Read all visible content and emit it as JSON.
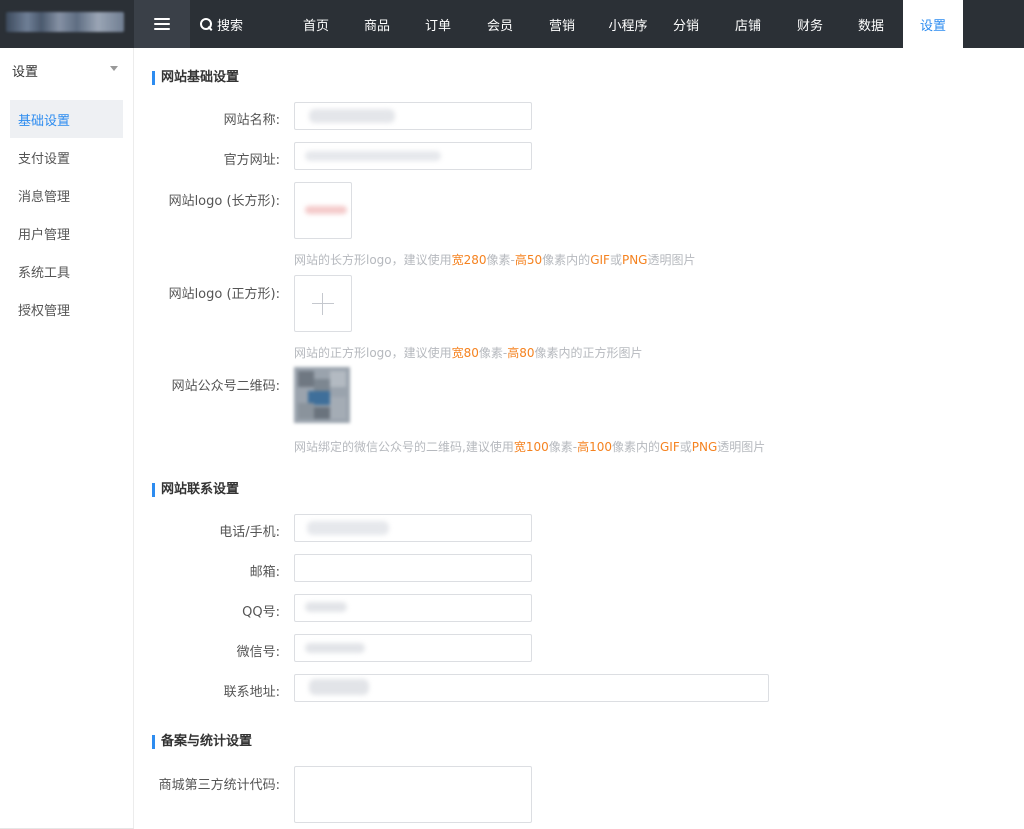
{
  "topbar": {
    "search_label": "搜索",
    "nav": [
      {
        "label": "首页"
      },
      {
        "label": "商品"
      },
      {
        "label": "订单"
      },
      {
        "label": "会员"
      },
      {
        "label": "营销"
      },
      {
        "label": "小程序"
      },
      {
        "label": "分销"
      },
      {
        "label": "店铺"
      },
      {
        "label": "财务"
      },
      {
        "label": "数据"
      },
      {
        "label": "设置",
        "active": true
      }
    ]
  },
  "sidebar": {
    "header": "设置",
    "items": [
      {
        "label": "基础设置",
        "active": true
      },
      {
        "label": "支付设置"
      },
      {
        "label": "消息管理"
      },
      {
        "label": "用户管理"
      },
      {
        "label": "系统工具"
      },
      {
        "label": "授权管理"
      }
    ]
  },
  "basic": {
    "title": "网站基础设置",
    "site_name_label": "网站名称:",
    "site_url_label": "官方网址:",
    "logo_rect_label": "网站logo (长方形):",
    "logo_rect_hint": {
      "pre": "网站的长方形logo，建议使用",
      "w": "宽280",
      "mid": "像素-",
      "h": "高50",
      "mid2": "像素内的",
      "fmt1": "GIF",
      "or": "或",
      "fmt2": "PNG",
      "post": "透明图片"
    },
    "logo_square_label": "网站logo (正方形):",
    "logo_square_hint": {
      "pre": "网站的正方形logo，建议使用",
      "w": "宽80",
      "mid": "像素-",
      "h": "高80",
      "post": "像素内的正方形图片"
    },
    "qr_label": "网站公众号二维码:",
    "qr_hint": {
      "pre": "网站绑定的微信公众号的二维码,建议使用",
      "w": "宽100",
      "mid": "像素-",
      "h": "高100",
      "mid2": "像素内的",
      "fmt1": "GIF",
      "or": "或",
      "fmt2": "PNG",
      "post": "透明图片"
    }
  },
  "contact": {
    "title": "网站联系设置",
    "phone_label": "电话/手机:",
    "email_label": "邮箱:",
    "qq_label": "QQ号:",
    "wechat_label": "微信号:",
    "address_label": "联系地址:"
  },
  "stats": {
    "title": "备案与统计设置",
    "code_label": "商城第三方统计代码:"
  },
  "colors": {
    "accent": "#2d8cf0",
    "topbar": "#2b3036",
    "highlight": "#f5821f"
  }
}
